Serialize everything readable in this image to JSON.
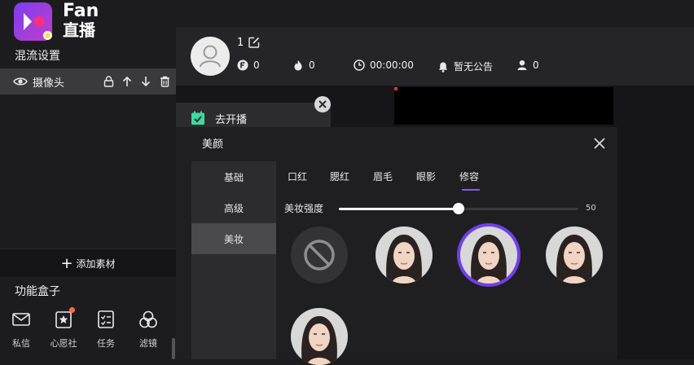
{
  "app": {
    "title": "Fan",
    "subtitle": "直播"
  },
  "sidebar": {
    "mix_title": "混流设置",
    "sources": [
      {
        "name": "摄像头"
      }
    ],
    "add_label": "添加素材",
    "func_title": "功能盒子",
    "func_items": [
      {
        "label": "私信",
        "icon": "mail-icon"
      },
      {
        "label": "心愿社",
        "icon": "wish-icon"
      },
      {
        "label": "任务",
        "icon": "task-icon"
      },
      {
        "label": "滤镜",
        "icon": "filter-icon"
      }
    ]
  },
  "header": {
    "username": "1",
    "coins": "0",
    "heat": "0",
    "timer": "00:00:00",
    "announcement": "暂无公告",
    "viewers": "0"
  },
  "go_live": {
    "label": "去开播"
  },
  "beauty": {
    "title": "美颜",
    "categories": [
      "基础",
      "高级",
      "美妆"
    ],
    "active_category": "美妆",
    "tabs": [
      "口红",
      "腮红",
      "眉毛",
      "眼影",
      "修容"
    ],
    "active_tab": "修容",
    "slider": {
      "label": "美妆强度",
      "value": 50,
      "max": 100
    },
    "selected_style": 2
  },
  "colors": {
    "accent": "#6e40e8",
    "notify": "#ff6a3d"
  }
}
